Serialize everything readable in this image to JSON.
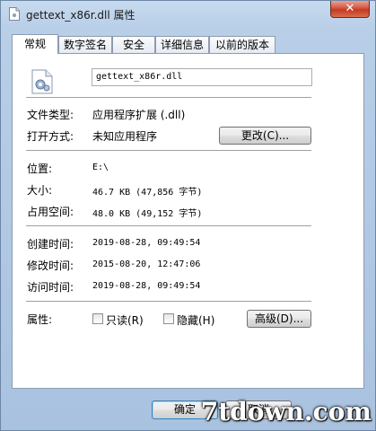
{
  "window": {
    "title": "gettext_x86r.dll 属性",
    "close_label": "✕"
  },
  "tabs": [
    {
      "label": "常规"
    },
    {
      "label": "数字签名"
    },
    {
      "label": "安全"
    },
    {
      "label": "详细信息"
    },
    {
      "label": "以前的版本"
    }
  ],
  "general": {
    "filename": "gettext_x86r.dll",
    "type_label": "文件类型:",
    "type_value": "应用程序扩展 (.dll)",
    "opens_label": "打开方式:",
    "opens_value": "未知应用程序",
    "change_button": "更改(C)...",
    "location_label": "位置:",
    "location_value": "E:\\",
    "size_label": "大小:",
    "size_value": "46.7 KB (47,856 字节)",
    "disk_size_label": "占用空间:",
    "disk_size_value": "48.0 KB (49,152 字节)",
    "created_label": "创建时间:",
    "created_value": "2019-08-28, 09:49:54",
    "modified_label": "修改时间:",
    "modified_value": "2015-08-20, 12:47:06",
    "accessed_label": "访问时间:",
    "accessed_value": "2019-08-28, 09:49:54",
    "attributes_label": "属性:",
    "readonly_label": "只读(R)",
    "hidden_label": "隐藏(H)",
    "advanced_button": "高级(D)..."
  },
  "footer": {
    "ok_button": "确定",
    "cancel_button": "取消"
  },
  "watermark": "7tdown.com"
}
